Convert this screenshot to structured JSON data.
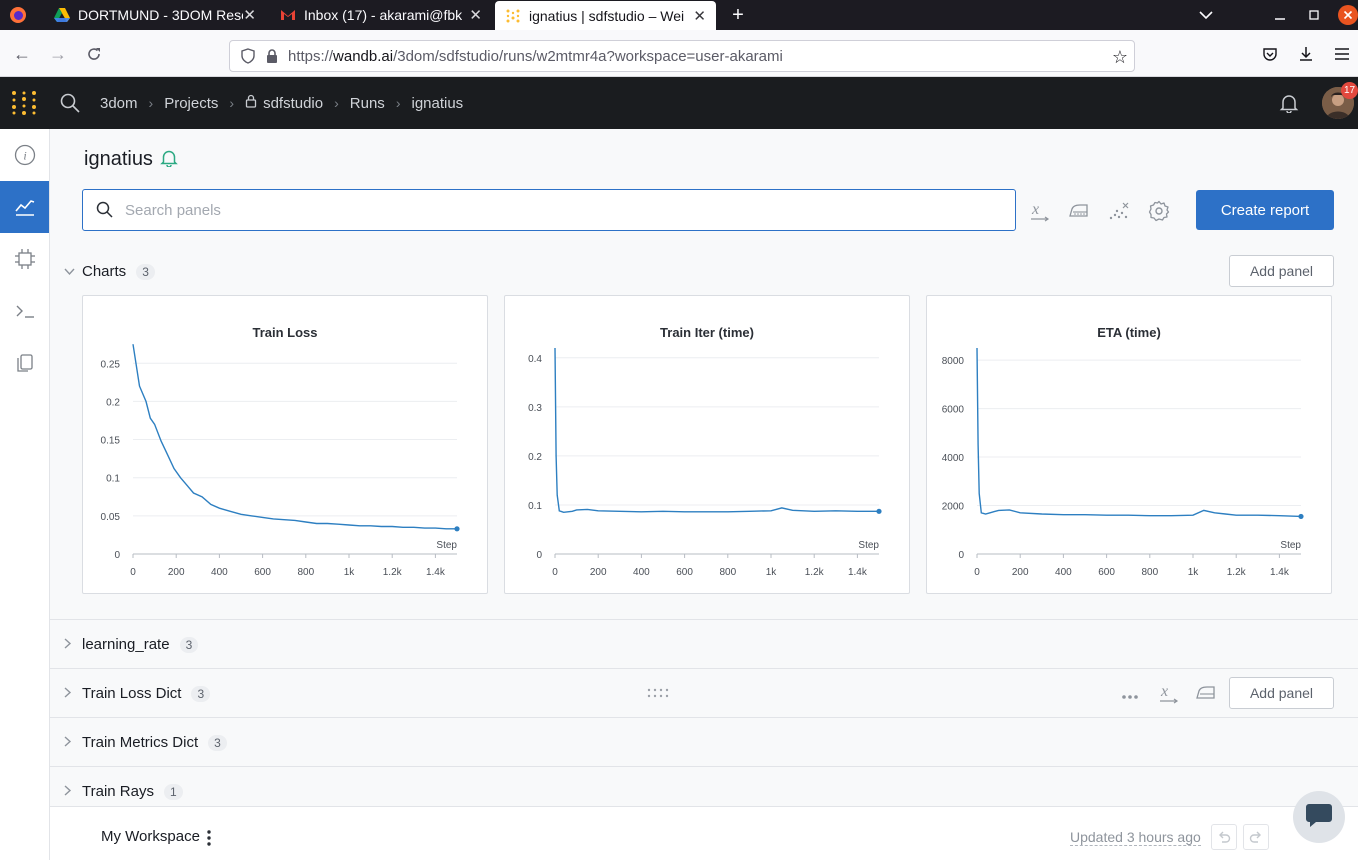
{
  "browser": {
    "tabs": [
      {
        "title": "DORTMUND - 3DOM Rese",
        "icon": "google-drive-icon"
      },
      {
        "title": "Inbox (17) - akarami@fbk",
        "icon": "gmail-icon"
      },
      {
        "title": "ignatius | sdfstudio – Wei",
        "icon": "wandb-icon",
        "active": true
      }
    ],
    "url_host": "wandb.ai",
    "url_prefix": "https://",
    "url_path": "/3dom/sdfstudio/runs/w2mtmr4a?workspace=user-akarami"
  },
  "header": {
    "breadcrumb": [
      "3dom",
      "Projects",
      "sdfstudio",
      "Runs",
      "ignatius"
    ],
    "notification_count": "17"
  },
  "run": {
    "title": "ignatius"
  },
  "search": {
    "placeholder": "Search panels"
  },
  "toolbar": {
    "create_report_label": "Create report",
    "add_panel_label": "Add panel"
  },
  "sections": [
    {
      "name": "Charts",
      "count": "3",
      "expanded": true
    },
    {
      "name": "learning_rate",
      "count": "3",
      "expanded": false
    },
    {
      "name": "Train Loss Dict",
      "count": "3",
      "expanded": false
    },
    {
      "name": "Train Metrics Dict",
      "count": "3",
      "expanded": false
    },
    {
      "name": "Train Rays",
      "count": "1",
      "expanded": false
    }
  ],
  "chart_data": [
    {
      "type": "line",
      "title": "Train Loss",
      "xlabel": "Step",
      "ylabel": "",
      "xlim": [
        0,
        1500
      ],
      "ylim": [
        0,
        0.27
      ],
      "xticks": [
        0,
        200,
        400,
        600,
        800,
        1000,
        1200,
        1400
      ],
      "xtick_labels": [
        "0",
        "200",
        "400",
        "600",
        "800",
        "1k",
        "1.2k",
        "1.4k"
      ],
      "yticks": [
        0,
        0.05,
        0.1,
        0.15,
        0.2,
        0.25
      ],
      "ytick_labels": [
        "0",
        "0.05",
        "0.1",
        "0.15",
        "0.2",
        "0.25"
      ],
      "color": "#2d7fc1",
      "series": [
        {
          "x": [
            0,
            30,
            60,
            80,
            100,
            130,
            160,
            190,
            220,
            250,
            280,
            320,
            360,
            400,
            450,
            500,
            550,
            600,
            650,
            700,
            750,
            800,
            850,
            900,
            950,
            1000,
            1050,
            1100,
            1150,
            1200,
            1250,
            1300,
            1350,
            1400,
            1450,
            1500
          ],
          "y": [
            0.275,
            0.22,
            0.2,
            0.178,
            0.17,
            0.148,
            0.13,
            0.112,
            0.1,
            0.09,
            0.08,
            0.075,
            0.065,
            0.06,
            0.056,
            0.052,
            0.05,
            0.048,
            0.046,
            0.045,
            0.044,
            0.042,
            0.04,
            0.04,
            0.039,
            0.038,
            0.037,
            0.037,
            0.036,
            0.036,
            0.035,
            0.035,
            0.034,
            0.034,
            0.033,
            0.033
          ]
        }
      ]
    },
    {
      "type": "line",
      "title": "Train Iter (time)",
      "xlabel": "Step",
      "ylabel": "",
      "xlim": [
        0,
        1500
      ],
      "ylim": [
        0,
        0.42
      ],
      "xticks": [
        0,
        200,
        400,
        600,
        800,
        1000,
        1200,
        1400
      ],
      "xtick_labels": [
        "0",
        "200",
        "400",
        "600",
        "800",
        "1k",
        "1.2k",
        "1.4k"
      ],
      "yticks": [
        0,
        0.1,
        0.2,
        0.3,
        0.4
      ],
      "ytick_labels": [
        "0",
        "0.1",
        "0.2",
        "0.3",
        "0.4"
      ],
      "color": "#2d7fc1",
      "series": [
        {
          "x": [
            0,
            5,
            10,
            20,
            40,
            60,
            80,
            100,
            150,
            200,
            300,
            400,
            500,
            600,
            700,
            800,
            900,
            1000,
            1050,
            1100,
            1150,
            1200,
            1300,
            1400,
            1500
          ],
          "y": [
            0.42,
            0.2,
            0.12,
            0.088,
            0.085,
            0.086,
            0.087,
            0.09,
            0.091,
            0.088,
            0.087,
            0.086,
            0.087,
            0.086,
            0.086,
            0.086,
            0.087,
            0.088,
            0.094,
            0.089,
            0.088,
            0.087,
            0.088,
            0.087,
            0.087
          ]
        }
      ]
    },
    {
      "type": "line",
      "title": "ETA (time)",
      "xlabel": "Step",
      "ylabel": "",
      "xlim": [
        0,
        1500
      ],
      "ylim": [
        0,
        8500
      ],
      "xticks": [
        0,
        200,
        400,
        600,
        800,
        1000,
        1200,
        1400
      ],
      "xtick_labels": [
        "0",
        "200",
        "400",
        "600",
        "800",
        "1k",
        "1.2k",
        "1.4k"
      ],
      "yticks": [
        0,
        2000,
        4000,
        6000,
        8000
      ],
      "ytick_labels": [
        "0",
        "2000",
        "4000",
        "6000",
        "8000"
      ],
      "color": "#2d7fc1",
      "series": [
        {
          "x": [
            0,
            5,
            10,
            20,
            40,
            60,
            80,
            100,
            150,
            200,
            300,
            400,
            500,
            600,
            700,
            800,
            900,
            1000,
            1050,
            1100,
            1150,
            1200,
            1300,
            1400,
            1500
          ],
          "y": [
            8500,
            4500,
            2500,
            1700,
            1650,
            1700,
            1750,
            1800,
            1820,
            1700,
            1650,
            1620,
            1620,
            1600,
            1600,
            1580,
            1580,
            1600,
            1800,
            1700,
            1650,
            1600,
            1600,
            1580,
            1550
          ]
        }
      ]
    }
  ],
  "footer": {
    "workspace_label": "My Workspace",
    "updated_text": "Updated 3 hours ago"
  }
}
